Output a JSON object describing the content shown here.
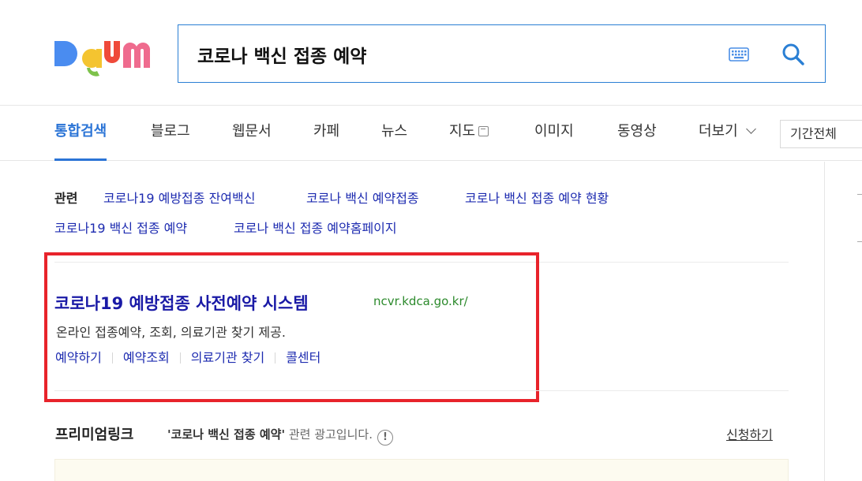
{
  "search": {
    "query": "코로나 백신 접종 예약"
  },
  "tabs": [
    {
      "label": "통합검색",
      "active": true
    },
    {
      "label": "블로그"
    },
    {
      "label": "웹문서"
    },
    {
      "label": "카페"
    },
    {
      "label": "뉴스"
    },
    {
      "label": "지도"
    },
    {
      "label": "이미지"
    },
    {
      "label": "동영상"
    },
    {
      "label": "더보기"
    }
  ],
  "period_filter": "기간전체",
  "related": {
    "label": "관련",
    "items": [
      "코로나19 예방접종 잔여백신",
      "코로나 백신 예약접종",
      "코로나 백신 접종 예약 현황",
      "코로나19 백신 접종 예약",
      "코로나 백신 접종 예약홈페이지"
    ]
  },
  "result": {
    "title": "코로나19 예방접종 사전예약 시스템",
    "url": "ncvr.kdca.go.kr/",
    "description": "온라인 접종예약, 조회, 의료기관 찾기 제공.",
    "sublinks": [
      "예약하기",
      "예약조회",
      "의료기관 찾기",
      "콜센터"
    ]
  },
  "premium": {
    "title": "프리미엄링크",
    "query_quoted": "'코로나 백신 접종 예약'",
    "suffix": " 관련 광고입니다.",
    "info_glyph": "!",
    "apply_label": "신청하기"
  },
  "colors": {
    "brand_blue": "#2b74d6",
    "link_blue": "#1d2bb0",
    "url_green": "#2c8a2c",
    "highlight_red": "#e8232b"
  }
}
